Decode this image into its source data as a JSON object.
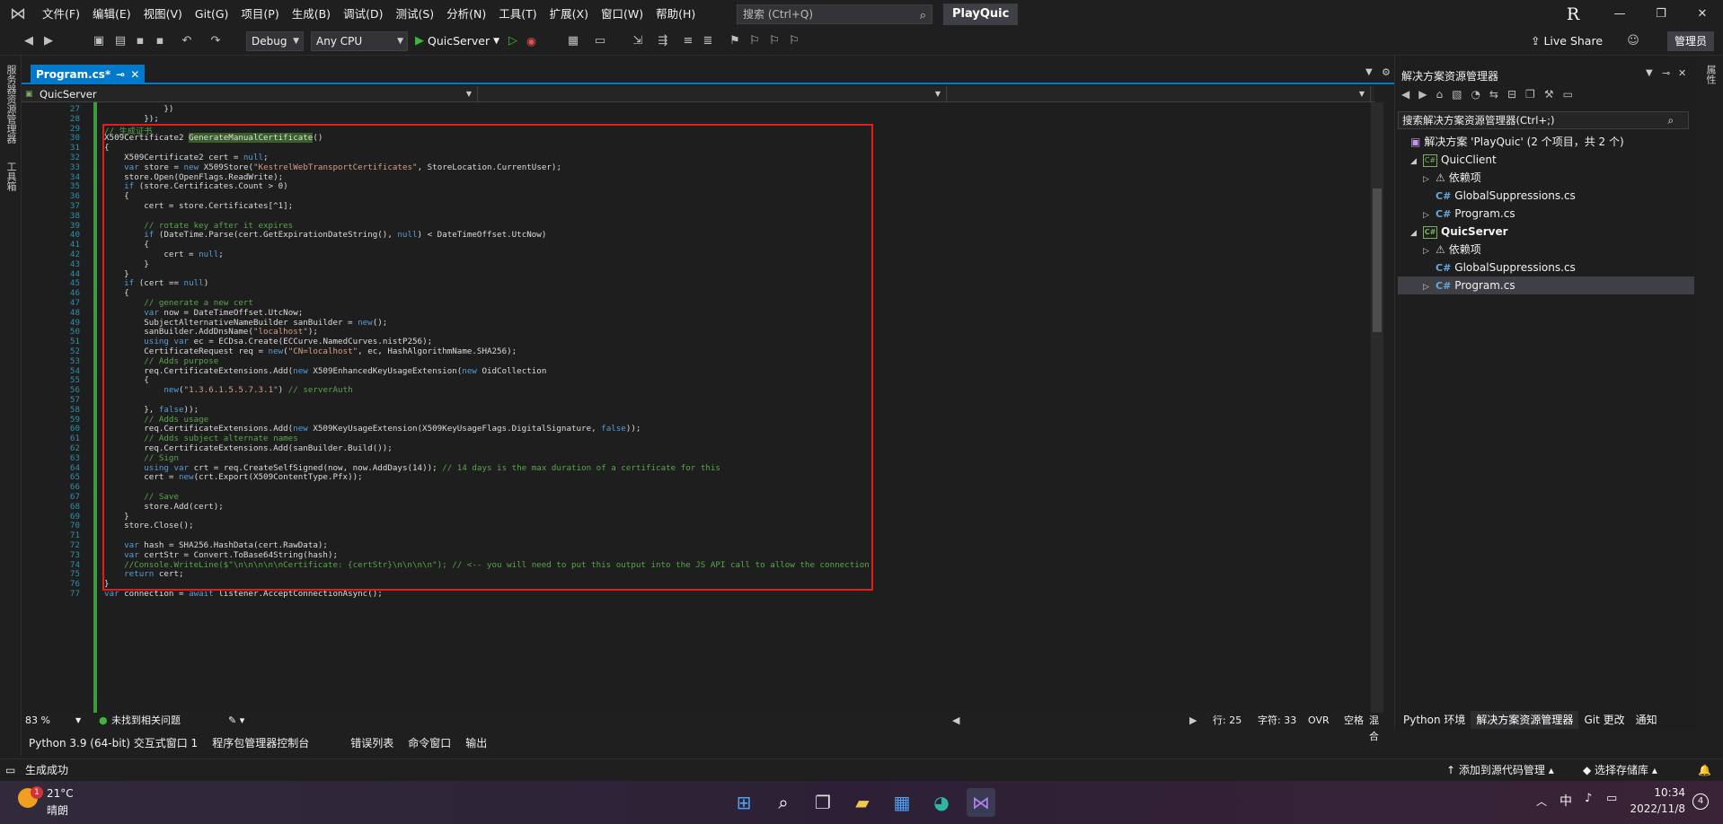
{
  "titlebar": {
    "menu": [
      "文件(F)",
      "编辑(E)",
      "视图(V)",
      "Git(G)",
      "项目(P)",
      "生成(B)",
      "调试(D)",
      "测试(S)",
      "分析(N)",
      "工具(T)",
      "扩展(X)",
      "窗口(W)",
      "帮助(H)"
    ],
    "search_placeholder": "搜索 (Ctrl+Q)",
    "solution_name": "PlayQuic",
    "user_initial": "R"
  },
  "toolbar": {
    "config": "Debug",
    "platform": "Any CPU",
    "startup_project": "QuicServer",
    "live_share": "Live Share",
    "admin": "管理员"
  },
  "left_strip": {
    "tab1": "服务器资源管理器",
    "tab2": "工具箱"
  },
  "editor": {
    "tab_label": "Program.cs*",
    "nav_left": "QuicServer",
    "zoom": "83 %",
    "issues": "未找到相关问题",
    "line": "行: 25",
    "col": "字符: 33",
    "ovr": "OVR",
    "whitespace": "空格",
    "eol": "混合"
  },
  "code_lines": [
    {
      "n": "27",
      "t": "            })"
    },
    {
      "n": "28",
      "t": "        });"
    },
    {
      "n": "29",
      "t": "// 生成证书"
    },
    {
      "n": "30",
      "t": "X509Certificate2 GenerateManualCertificate()"
    },
    {
      "n": "31",
      "t": "{"
    },
    {
      "n": "32",
      "t": "    X509Certificate2 cert = null;"
    },
    {
      "n": "33",
      "t": "    var store = new X509Store(\"KestrelWebTransportCertificates\", StoreLocation.CurrentUser);"
    },
    {
      "n": "34",
      "t": "    store.Open(OpenFlags.ReadWrite);"
    },
    {
      "n": "35",
      "t": "    if (store.Certificates.Count > 0)"
    },
    {
      "n": "36",
      "t": "    {"
    },
    {
      "n": "37",
      "t": "        cert = store.Certificates[^1];"
    },
    {
      "n": "38",
      "t": ""
    },
    {
      "n": "39",
      "t": "        // rotate key after it expires"
    },
    {
      "n": "40",
      "t": "        if (DateTime.Parse(cert.GetExpirationDateString(), null) < DateTimeOffset.UtcNow)"
    },
    {
      "n": "41",
      "t": "        {"
    },
    {
      "n": "42",
      "t": "            cert = null;"
    },
    {
      "n": "43",
      "t": "        }"
    },
    {
      "n": "44",
      "t": "    }"
    },
    {
      "n": "45",
      "t": "    if (cert == null)"
    },
    {
      "n": "46",
      "t": "    {"
    },
    {
      "n": "47",
      "t": "        // generate a new cert"
    },
    {
      "n": "48",
      "t": "        var now = DateTimeOffset.UtcNow;"
    },
    {
      "n": "49",
      "t": "        SubjectAlternativeNameBuilder sanBuilder = new();"
    },
    {
      "n": "50",
      "t": "        sanBuilder.AddDnsName(\"localhost\");"
    },
    {
      "n": "51",
      "t": "        using var ec = ECDsa.Create(ECCurve.NamedCurves.nistP256);"
    },
    {
      "n": "52",
      "t": "        CertificateRequest req = new(\"CN=localhost\", ec, HashAlgorithmName.SHA256);"
    },
    {
      "n": "53",
      "t": "        // Adds purpose"
    },
    {
      "n": "54",
      "t": "        req.CertificateExtensions.Add(new X509EnhancedKeyUsageExtension(new OidCollection"
    },
    {
      "n": "55",
      "t": "        {"
    },
    {
      "n": "56",
      "t": "            new(\"1.3.6.1.5.5.7.3.1\") // serverAuth"
    },
    {
      "n": "57",
      "t": ""
    },
    {
      "n": "58",
      "t": "        }, false));"
    },
    {
      "n": "59",
      "t": "        // Adds usage"
    },
    {
      "n": "60",
      "t": "        req.CertificateExtensions.Add(new X509KeyUsageExtension(X509KeyUsageFlags.DigitalSignature, false));"
    },
    {
      "n": "61",
      "t": "        // Adds subject alternate names"
    },
    {
      "n": "62",
      "t": "        req.CertificateExtensions.Add(sanBuilder.Build());"
    },
    {
      "n": "63",
      "t": "        // Sign"
    },
    {
      "n": "64",
      "t": "        using var crt = req.CreateSelfSigned(now, now.AddDays(14)); // 14 days is the max duration of a certificate for this"
    },
    {
      "n": "65",
      "t": "        cert = new(crt.Export(X509ContentType.Pfx));"
    },
    {
      "n": "66",
      "t": ""
    },
    {
      "n": "67",
      "t": "        // Save"
    },
    {
      "n": "68",
      "t": "        store.Add(cert);"
    },
    {
      "n": "69",
      "t": "    }"
    },
    {
      "n": "70",
      "t": "    store.Close();"
    },
    {
      "n": "71",
      "t": ""
    },
    {
      "n": "72",
      "t": "    var hash = SHA256.HashData(cert.RawData);"
    },
    {
      "n": "73",
      "t": "    var certStr = Convert.ToBase64String(hash);"
    },
    {
      "n": "74",
      "t": "    //Console.WriteLine($\"\\n\\n\\n\\n\\nCertificate: {certStr}\\n\\n\\n\\n\"); // <-- you will need to put this output into the JS API call to allow the connection"
    },
    {
      "n": "75",
      "t": "    return cert;"
    },
    {
      "n": "76",
      "t": "}"
    },
    {
      "n": "77",
      "t": "var connection = await listener.AcceptConnectionAsync();"
    }
  ],
  "solution_explorer": {
    "title": "解决方案资源管理器",
    "search_placeholder": "搜索解决方案资源管理器(Ctrl+;)",
    "solution": "解决方案 'PlayQuic' (2 个项目，共 2 个)",
    "items": [
      {
        "label": "QuicClient",
        "kind": "project",
        "bold": false
      },
      {
        "label": "依赖项",
        "kind": "ref"
      },
      {
        "label": "GlobalSuppressions.cs",
        "kind": "cs"
      },
      {
        "label": "Program.cs",
        "kind": "cs"
      },
      {
        "label": "QuicServer",
        "kind": "project",
        "bold": true
      },
      {
        "label": "依赖项",
        "kind": "ref"
      },
      {
        "label": "GlobalSuppressions.cs",
        "kind": "cs"
      },
      {
        "label": "Program.cs",
        "kind": "cs",
        "selected": true
      }
    ],
    "bottom_tabs": [
      "Python 环境",
      "解决方案资源管理器",
      "Git 更改",
      "通知"
    ]
  },
  "tool_tabs": [
    "Python 3.9 (64-bit) 交互式窗口 1",
    "程序包管理器控制台",
    "错误列表",
    "命令窗口",
    "输出"
  ],
  "statusbar": {
    "build": "生成成功",
    "add_source": "添加到源代码管理",
    "repo": "选择存储库"
  },
  "taskbar": {
    "weather_temp": "21°C",
    "weather_desc": "晴朗",
    "weather_badge": "1",
    "ime": "中",
    "time": "10:34",
    "date": "2022/11/8",
    "notif_count": "4"
  },
  "colors": {
    "accent": "#007acc",
    "highlight_box": "#e81b1b",
    "change_bar": "#3c9a3c"
  }
}
